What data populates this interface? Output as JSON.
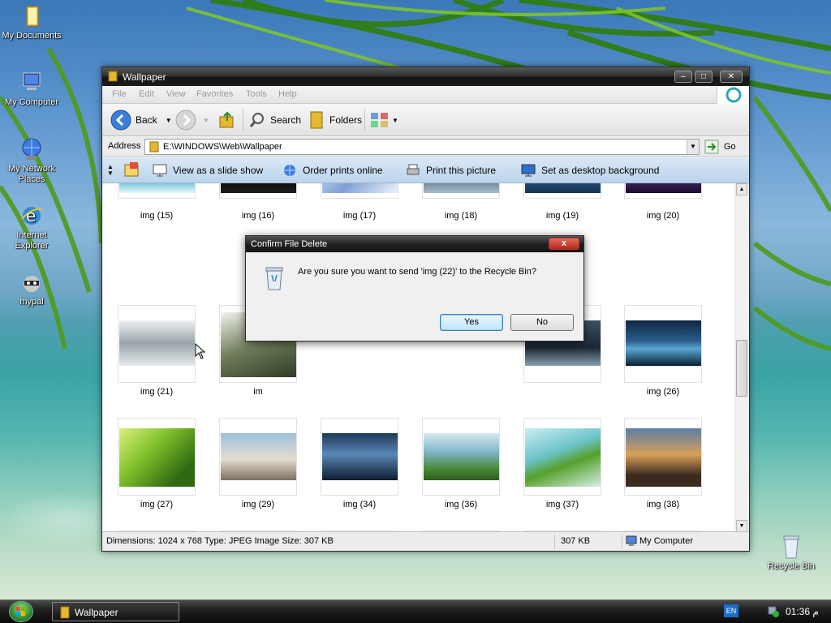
{
  "desktop": {
    "icons": [
      {
        "label": "My Documents"
      },
      {
        "label": "My Computer"
      },
      {
        "label": "My Network Places"
      },
      {
        "label": "Internet Explorer"
      },
      {
        "label": "mypal"
      },
      {
        "label": "Recycle Bin"
      }
    ]
  },
  "window": {
    "title": "Wallpaper",
    "menu": [
      "File",
      "Edit",
      "View",
      "Favorites",
      "Tools",
      "Help"
    ],
    "toolbar": {
      "back": "Back",
      "search": "Search",
      "folders": "Folders"
    },
    "address": {
      "label": "Address",
      "value": "E:\\WINDOWS\\Web\\Wallpaper",
      "go": "Go"
    },
    "tasks": {
      "slideshow": "View as a slide show",
      "order": "Order prints online",
      "print": "Print this picture",
      "background": "Set as desktop background"
    },
    "thumbnails": [
      {
        "label": "img (15)"
      },
      {
        "label": "img (16)"
      },
      {
        "label": "img (17)"
      },
      {
        "label": "img (18)"
      },
      {
        "label": "img (19)"
      },
      {
        "label": "img (20)"
      },
      {
        "label": "img (21)"
      },
      {
        "label": "im"
      },
      {
        "label": ""
      },
      {
        "label": ""
      },
      {
        "label": ""
      },
      {
        "label": "img (26)"
      },
      {
        "label": "img (27)"
      },
      {
        "label": "img (29)"
      },
      {
        "label": "img (34)"
      },
      {
        "label": "img (36)"
      },
      {
        "label": "img (37)"
      },
      {
        "label": "img (38)"
      },
      {
        "label": ""
      },
      {
        "label": ""
      },
      {
        "label": ""
      },
      {
        "label": ""
      },
      {
        "label": ""
      },
      {
        "label": ""
      }
    ],
    "status": {
      "details": "Dimensions: 1024 x 768 Type: JPEG Image Size: 307 KB",
      "size": "307 KB",
      "zone": "My Computer"
    }
  },
  "dialog": {
    "title": "Confirm File Delete",
    "close": "x",
    "message": "Are you sure you want to send 'img (22)' to the Recycle Bin?",
    "yes": "Yes",
    "no": "No"
  },
  "taskbar": {
    "task": "Wallpaper",
    "language": "EN",
    "clock": "01:36 م"
  }
}
